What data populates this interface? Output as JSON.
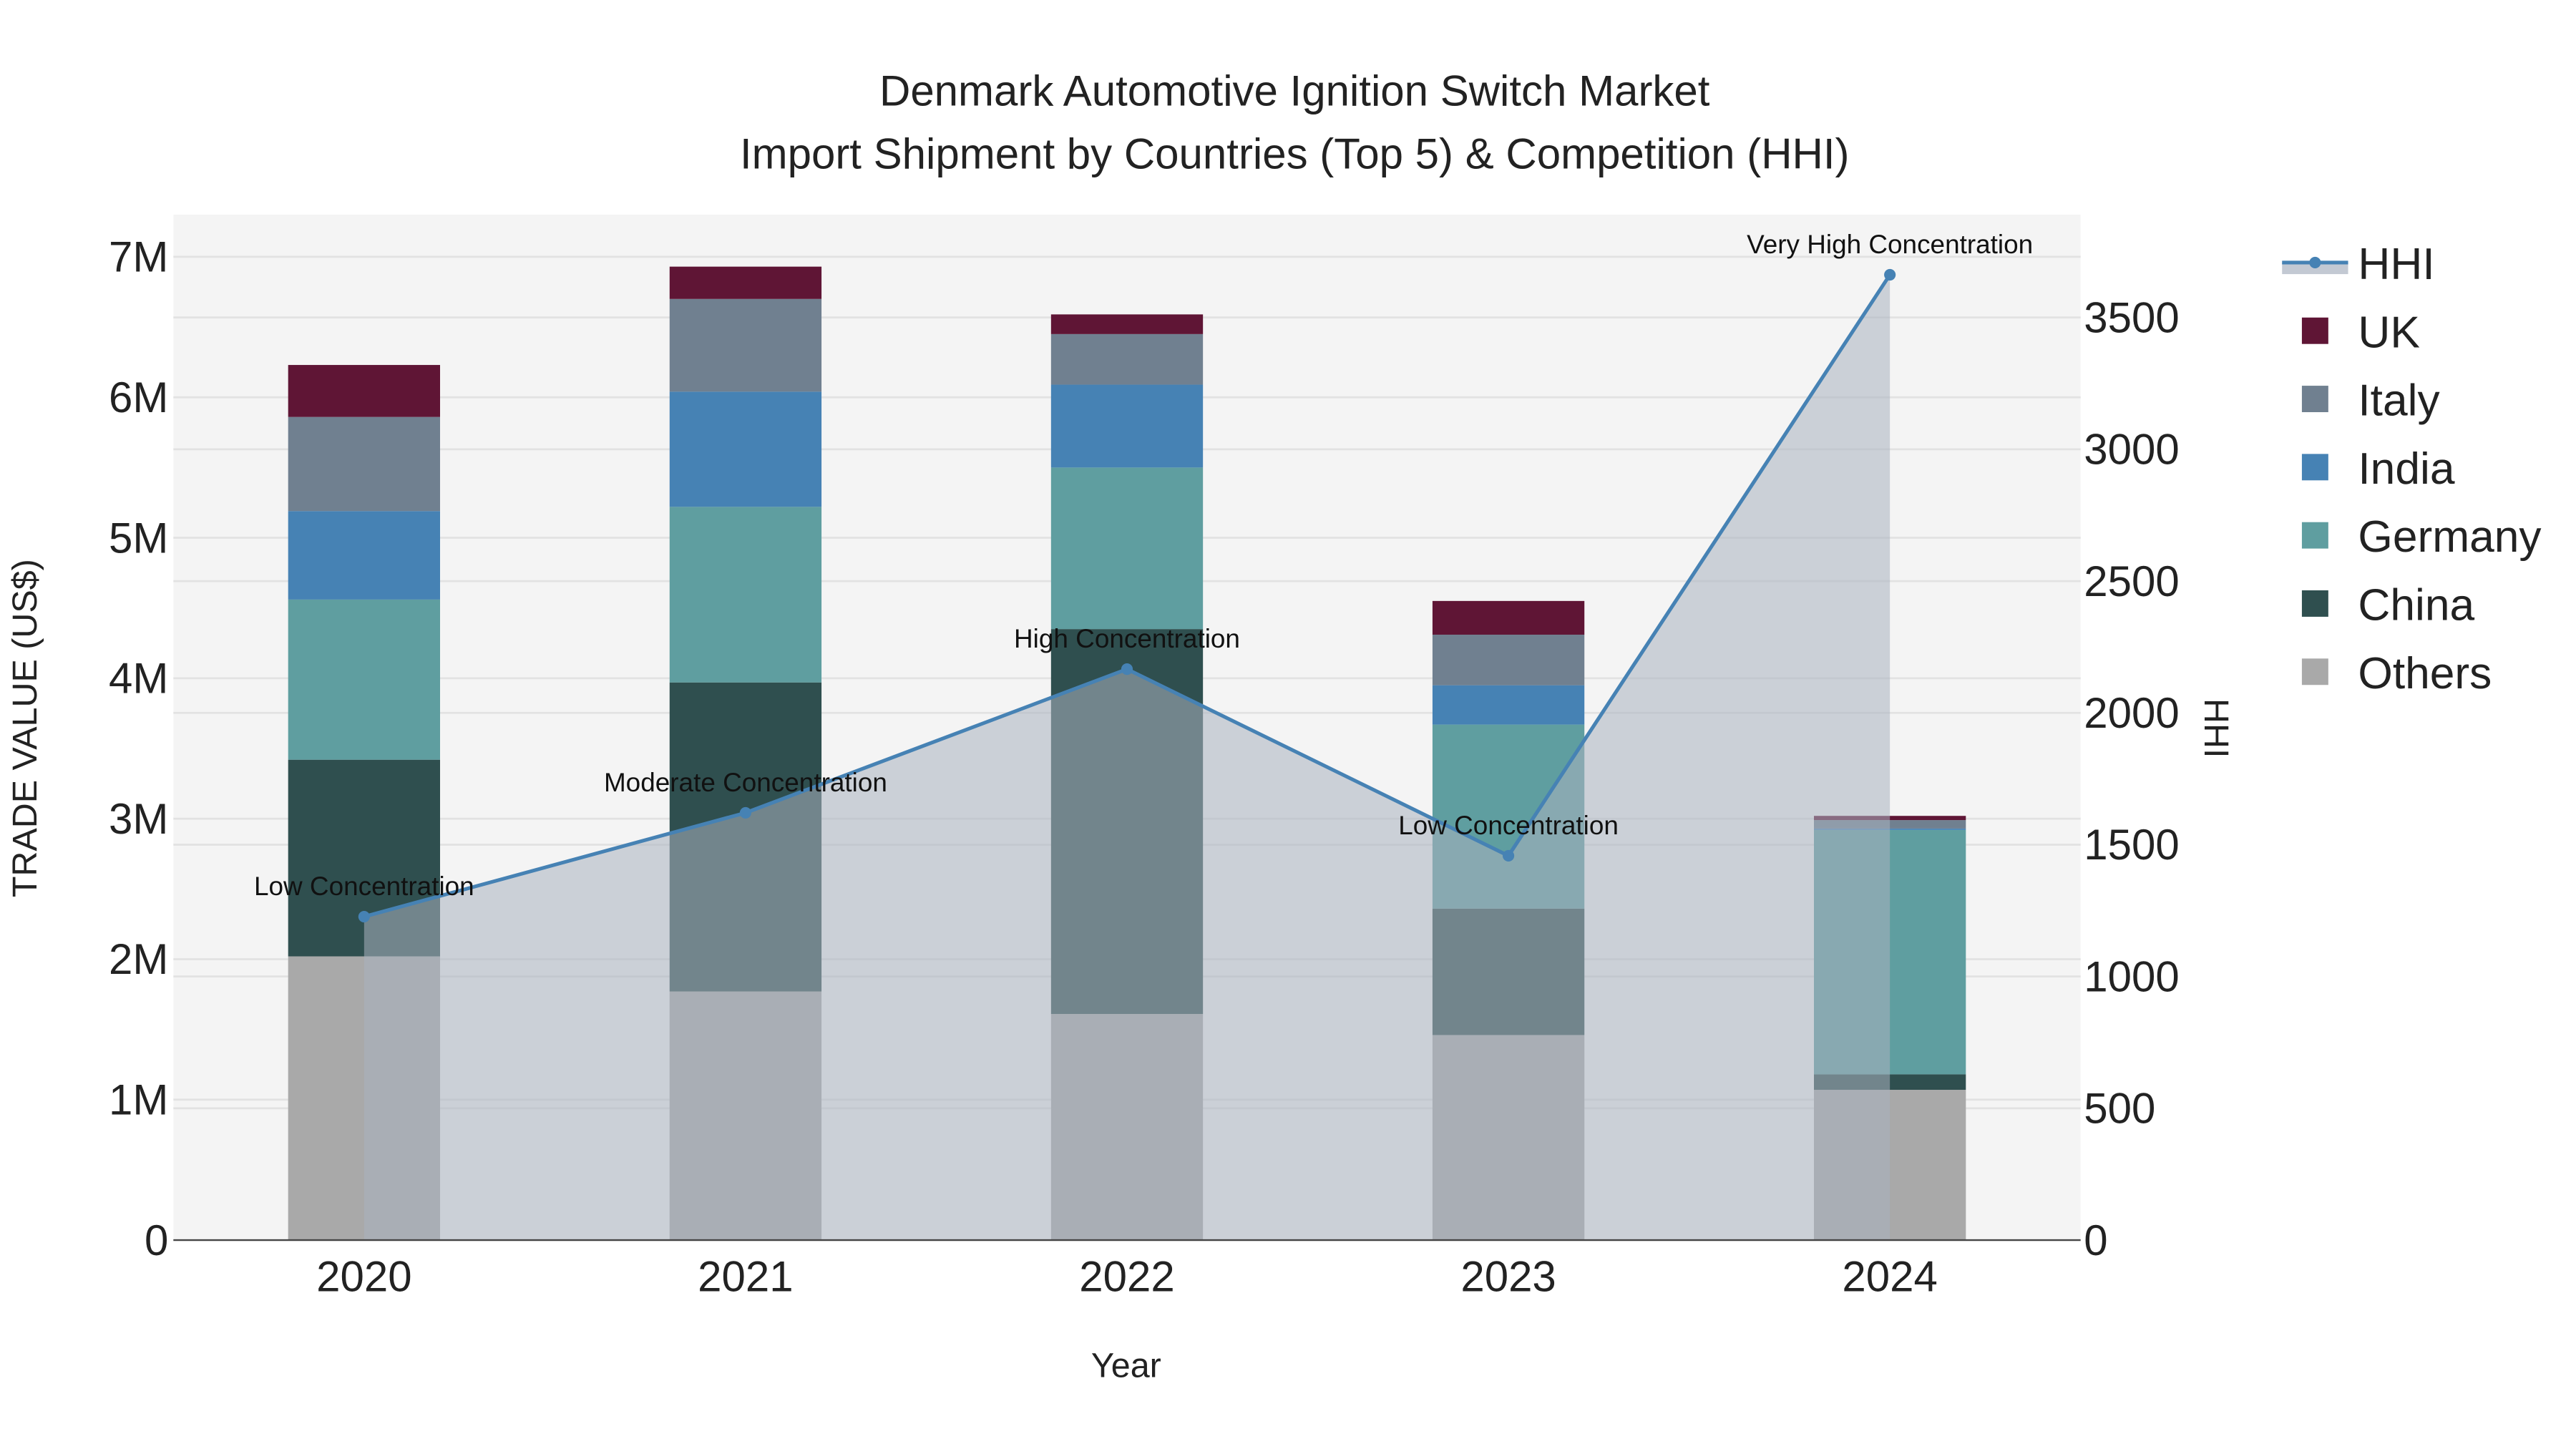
{
  "chart_data": {
    "type": "bar",
    "title_line1": "Denmark Automotive Ignition Switch Market",
    "title_line2": "Import Shipment by Countries (Top 5) & Competition (HHI)",
    "xlabel": "Year",
    "ylabel": "TRADE VALUE (US$)",
    "y2label": "HHI",
    "categories": [
      "2020",
      "2021",
      "2022",
      "2023",
      "2024"
    ],
    "ylim": [
      0,
      7300000
    ],
    "y2lim": [
      0,
      3890
    ],
    "yticks": [
      {
        "v": 0,
        "label": "0"
      },
      {
        "v": 1000000,
        "label": "1M"
      },
      {
        "v": 2000000,
        "label": "2M"
      },
      {
        "v": 3000000,
        "label": "3M"
      },
      {
        "v": 4000000,
        "label": "4M"
      },
      {
        "v": 5000000,
        "label": "5M"
      },
      {
        "v": 6000000,
        "label": "6M"
      },
      {
        "v": 7000000,
        "label": "7M"
      }
    ],
    "y2ticks": [
      {
        "v": 0,
        "label": "0"
      },
      {
        "v": 500,
        "label": "500"
      },
      {
        "v": 1000,
        "label": "1000"
      },
      {
        "v": 1500,
        "label": "1500"
      },
      {
        "v": 2000,
        "label": "2000"
      },
      {
        "v": 2500,
        "label": "2500"
      },
      {
        "v": 3000,
        "label": "3000"
      },
      {
        "v": 3500,
        "label": "3500"
      }
    ],
    "series": [
      {
        "name": "Others",
        "color": "#a9a9a9",
        "values": [
          2020000,
          1770000,
          1610000,
          1460000,
          1070000
        ]
      },
      {
        "name": "China",
        "color": "#2f4f4f",
        "values": [
          1400000,
          2200000,
          2740000,
          900000,
          110000
        ]
      },
      {
        "name": "Germany",
        "color": "#5f9ea0",
        "values": [
          1140000,
          1250000,
          1150000,
          1310000,
          1740000
        ]
      },
      {
        "name": "India",
        "color": "#4682b4",
        "values": [
          630000,
          820000,
          590000,
          280000,
          10000
        ]
      },
      {
        "name": "Italy",
        "color": "#708090",
        "values": [
          670000,
          660000,
          360000,
          360000,
          60000
        ]
      },
      {
        "name": "UK",
        "color": "#5f1535",
        "values": [
          370000,
          230000,
          140000,
          240000,
          30000
        ]
      }
    ],
    "hhi": {
      "name": "HHI",
      "color": "#4682b4",
      "values": [
        1227,
        1621,
        2166,
        1458,
        3662
      ],
      "annotations": [
        "Low Concentration",
        "Moderate Concentration",
        "High Concentration",
        "Low Concentration",
        "Very High Concentration"
      ]
    },
    "legend": [
      "HHI",
      "UK",
      "Italy",
      "India",
      "Germany",
      "China",
      "Others"
    ],
    "legend_position": "right"
  }
}
